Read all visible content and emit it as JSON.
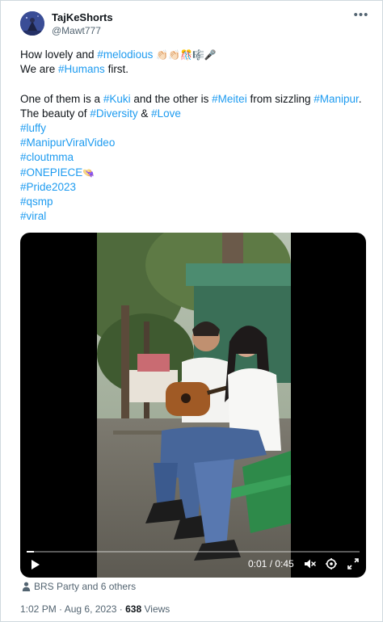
{
  "author": {
    "display_name": "TajKeShorts",
    "handle": "@Mawt777"
  },
  "tweet": {
    "line1_prefix": "How lovely and ",
    "line1_tag": "#melodious",
    "line1_emoji": "👏🏻👏🏻🎊🎼🎤",
    "line2_prefix": "We are ",
    "line2_tag": "#Humans",
    "line2_suffix": " first.",
    "line3_a": "One of them is a ",
    "line3_tag1": "#Kuki",
    "line3_b": " and the other is ",
    "line3_tag2": "#Meitei",
    "line3_c": " from sizzling ",
    "line3_tag3": "#Manipur",
    "line3_d": ".",
    "line4_a": "The beauty of ",
    "line4_tag1": "#Diversity",
    "line4_b": " & ",
    "line4_tag2": "#Love",
    "hashtags": [
      "#luffy",
      "#ManipurViralVideo",
      "#cloutmma",
      "#ONEPIECE",
      "#Pride2023",
      "#qsmp",
      "#viral"
    ],
    "onepiece_emoji": "👒"
  },
  "video": {
    "elapsed": "0:01",
    "separator": " / ",
    "duration": "0:45",
    "progress_fraction": 0.022
  },
  "social_context": "BRS Party and 6 others",
  "meta": {
    "time": "1:02 PM",
    "dot1": " · ",
    "date": "Aug 6, 2023",
    "dot2": " · ",
    "views_count": "638",
    "views_label": " Views"
  },
  "icons": {
    "more": "more-icon",
    "play": "play-icon",
    "mute": "mute-icon",
    "settings": "settings-icon",
    "fullscreen": "fullscreen-icon",
    "person": "person-icon"
  },
  "colors": {
    "link": "#1d9bf0",
    "secondary": "#536471",
    "border": "#cfd9de"
  }
}
